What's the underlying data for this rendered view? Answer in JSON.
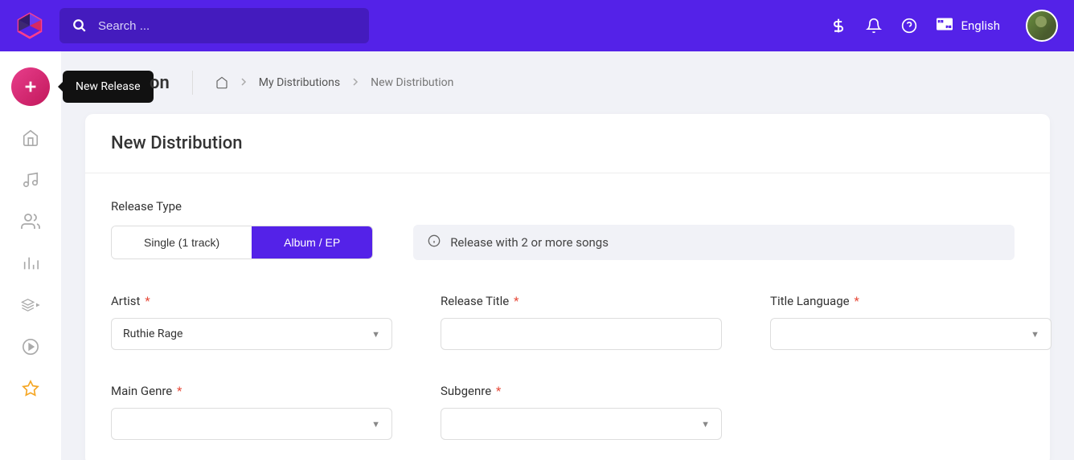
{
  "header": {
    "search_placeholder": "Search ...",
    "language_label": "English"
  },
  "sidebar": {
    "tooltip": "New Release"
  },
  "page": {
    "title_suffix": "on",
    "breadcrumbs": {
      "item1": "My Distributions",
      "item2": "New Distribution"
    }
  },
  "card": {
    "title": "New Distribution",
    "release_type_label": "Release Type",
    "toggle": {
      "single": "Single (1 track)",
      "album": "Album / EP"
    },
    "info_text": "Release with 2 or more songs",
    "fields": {
      "artist_label": "Artist",
      "artist_value": "Ruthie Rage",
      "release_title_label": "Release Title",
      "release_title_value": "",
      "title_language_label": "Title Language",
      "title_language_value": "",
      "main_genre_label": "Main Genre",
      "main_genre_value": "",
      "subgenre_label": "Subgenre",
      "subgenre_value": ""
    }
  }
}
